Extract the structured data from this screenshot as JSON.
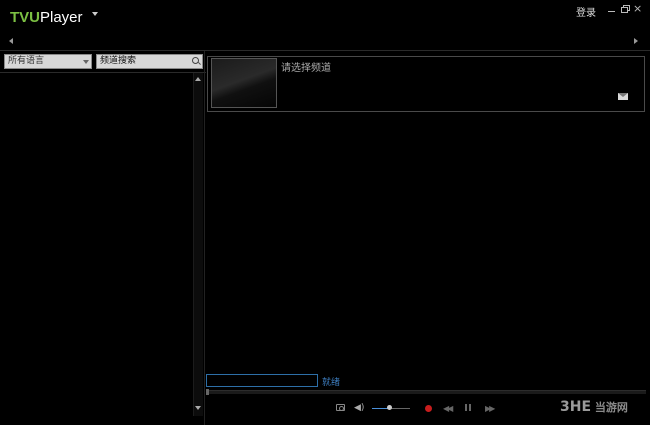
{
  "window": {
    "app_name_part1": "TVU",
    "app_name_part2": "Player",
    "login_label": "登录",
    "close_glyph": "×"
  },
  "sidebar": {
    "language_select": {
      "selected": "所有语言"
    },
    "search": {
      "placeholder": "频道搜索"
    }
  },
  "info_panel": {
    "prompt": "请选择频道"
  },
  "status": {
    "text": "就绪"
  },
  "playback": {
    "prev_glyph": "◀◀",
    "next_glyph": "▶▶",
    "volume_glyph": "◀)",
    "volume_level": 0.45,
    "record_color": "#c81d1d",
    "accent_color": "#4a90d9"
  },
  "watermark": {
    "text_big": "3HE",
    "text_small": "当游网"
  },
  "colors": {
    "brand_green": "#7cc043",
    "status_blue": "#3d7dbf"
  }
}
